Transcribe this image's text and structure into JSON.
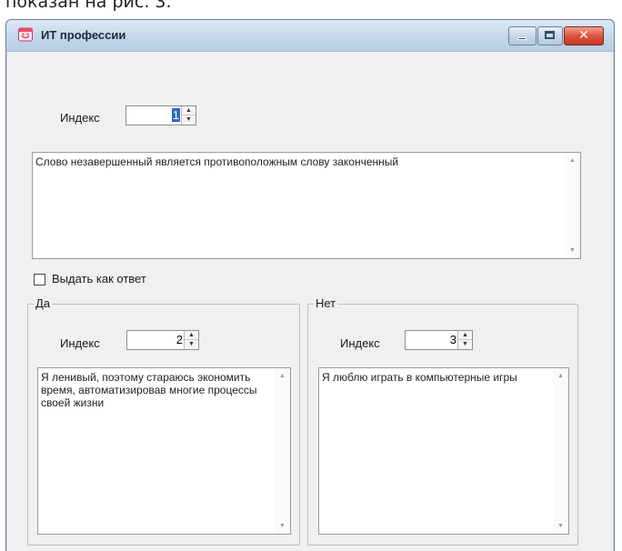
{
  "caption_fragment": "показан на рис. 3.",
  "window": {
    "title": "ИТ профессии",
    "icon": "application-icon",
    "buttons": {
      "minimize": "minimize-icon",
      "maximize": "maximize-icon",
      "close": "close-icon",
      "close_glyph": "✕"
    }
  },
  "main": {
    "index_label": "Индекс",
    "index_value": "1",
    "question_text": "Слово незавершенный является противоположным слову законченный",
    "answer_checkbox": {
      "label": "Выдать как ответ",
      "checked": false
    }
  },
  "yes_group": {
    "title": "Да",
    "index_label": "Индекс",
    "index_value": "2",
    "text": "Я ленивый, поэтому стараюсь экономить время, автоматизировав многие процессы своей жизни"
  },
  "no_group": {
    "title": "Нет",
    "index_label": "Индекс",
    "index_value": "3",
    "text": "Я люблю играть в компьютерные игры"
  },
  "colors": {
    "selection": "#3168c5",
    "close_button": "#d9543d",
    "titlebar": "#c2d5ea",
    "client_bg": "#f0f0f0"
  }
}
